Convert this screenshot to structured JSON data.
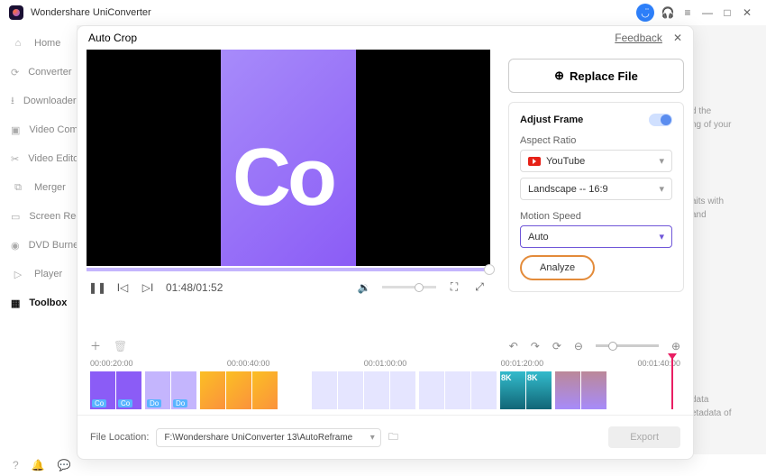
{
  "app": {
    "title": "Wondershare UniConverter"
  },
  "titlebar_icons": {
    "help": "?",
    "headset": "🎧",
    "menu": "≡",
    "min": "—",
    "max": "□",
    "close": "✕"
  },
  "sidebar": {
    "items": [
      {
        "icon": "⌂",
        "label": "Home"
      },
      {
        "icon": "⟳",
        "label": "Converter"
      },
      {
        "icon": "⭳",
        "label": "Downloader"
      },
      {
        "icon": "▣",
        "label": "Video Compressor"
      },
      {
        "icon": "✂",
        "label": "Video Editor"
      },
      {
        "icon": "⧉",
        "label": "Merger"
      },
      {
        "icon": "▭",
        "label": "Screen Recorder"
      },
      {
        "icon": "◉",
        "label": "DVD Burner"
      },
      {
        "icon": "▷",
        "label": "Player"
      },
      {
        "icon": "▦",
        "label": "Toolbox"
      }
    ]
  },
  "modal": {
    "title": "Auto Crop",
    "feedback": "Feedback",
    "close": "✕",
    "replace_label": "Replace File",
    "panel": {
      "heading": "Adjust Frame",
      "aspect_label": "Aspect Ratio",
      "platform": "YouTube",
      "ratio": "Landscape -- 16:9",
      "motion_label": "Motion Speed",
      "motion_value": "Auto",
      "analyze": "Analyze"
    }
  },
  "playback": {
    "time": "01:48/01:52"
  },
  "timeline": {
    "marks": [
      "00:00:20:00",
      "00:00:40:00",
      "00:01:00:00",
      "00:01:20:00",
      "00:01:40:00"
    ]
  },
  "footer": {
    "location_label": "File Location:",
    "path": "F:\\Wondershare UniConverter 13\\AutoReframe",
    "export": "Export"
  },
  "right_hints": [
    "d the",
    "ng of your",
    "aits with",
    "and",
    "data",
    "etadata of"
  ]
}
